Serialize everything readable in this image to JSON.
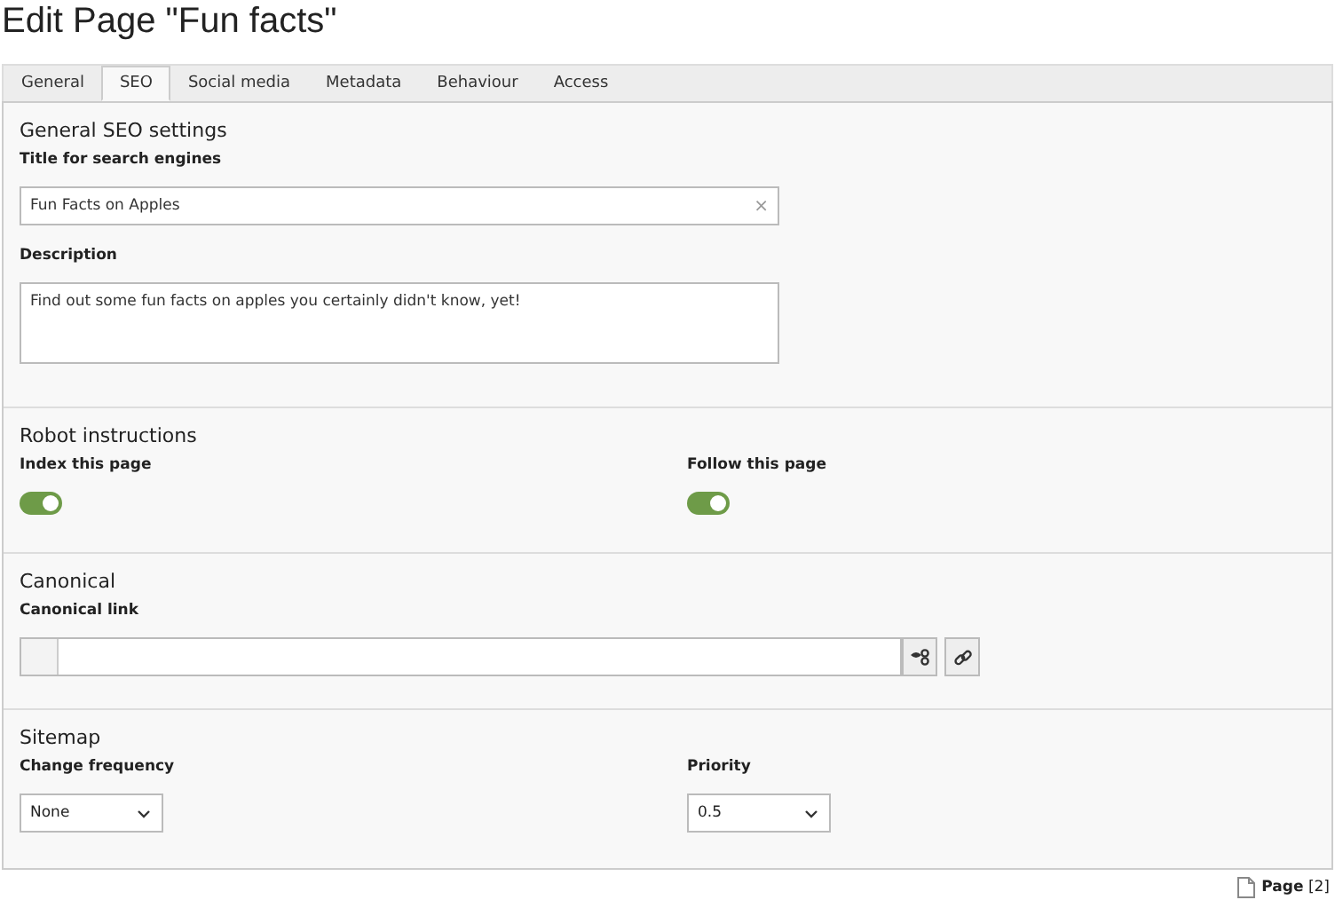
{
  "page_title": "Edit Page \"Fun facts\"",
  "tabs": [
    {
      "label": "General",
      "selected": false
    },
    {
      "label": "SEO",
      "selected": true
    },
    {
      "label": "Social media",
      "selected": false
    },
    {
      "label": "Metadata",
      "selected": false
    },
    {
      "label": "Behaviour",
      "selected": false
    },
    {
      "label": "Access",
      "selected": false
    }
  ],
  "sections": [
    {
      "title": "General SEO settings",
      "fields": [
        {
          "kind": "text",
          "label": "Title for search engines",
          "value": "Fun Facts on Apples",
          "clear": "×"
        },
        {
          "kind": "textarea",
          "label": "Description",
          "value": "Find out some fun facts on apples you certainly didn't know, yet!"
        }
      ]
    },
    {
      "title": "Robot instructions",
      "fields": [
        {
          "kind": "toggle",
          "label": "Index this page",
          "on": true
        },
        {
          "kind": "toggle",
          "label": "Follow this page",
          "on": true
        }
      ]
    },
    {
      "title": "Canonical",
      "fields": [
        {
          "kind": "link",
          "label": "Canonical link"
        }
      ]
    },
    {
      "title": "Sitemap",
      "fields": [
        {
          "kind": "select",
          "label": "Change frequency",
          "value": "None"
        },
        {
          "kind": "select",
          "label": "Priority",
          "value": "0.5"
        }
      ]
    }
  ],
  "footer": "**Page** [2]"
}
